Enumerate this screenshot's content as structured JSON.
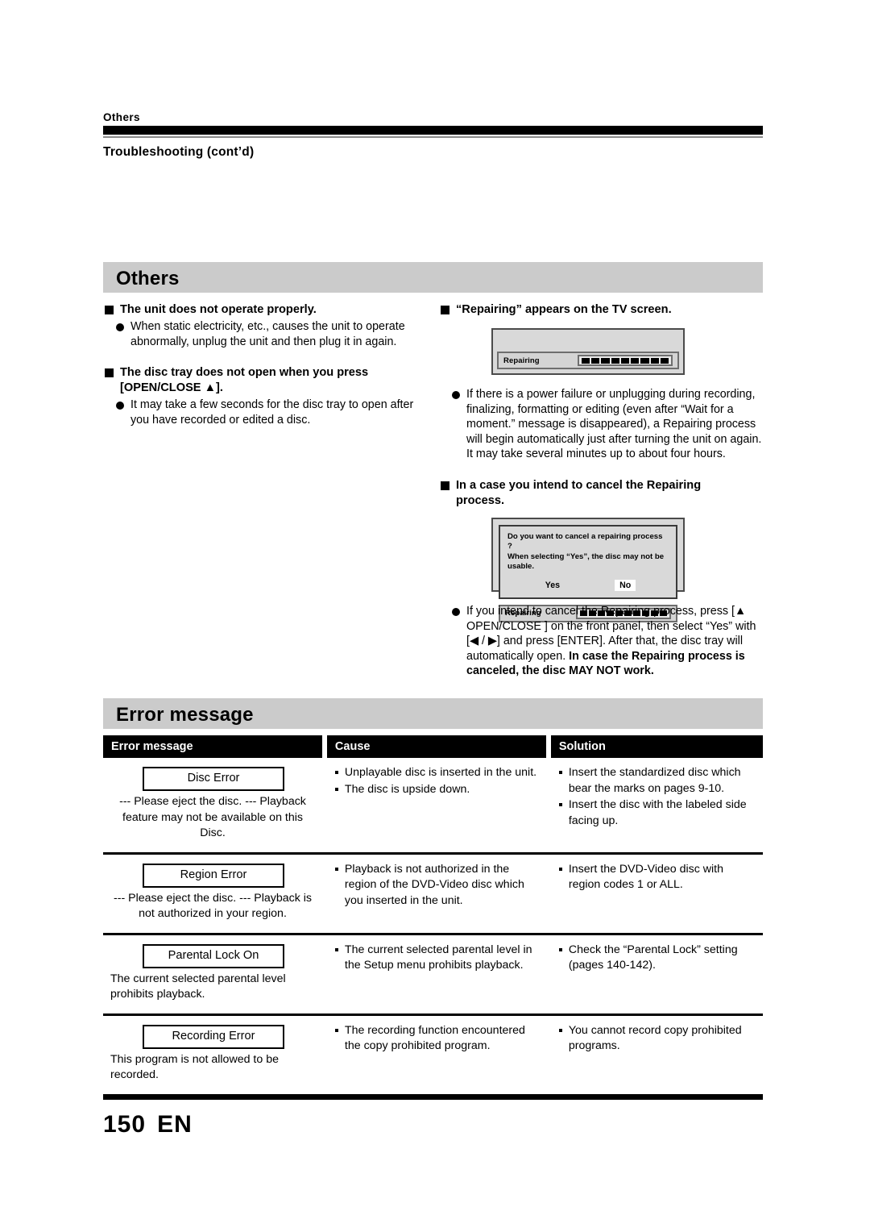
{
  "runhead": {
    "category": "Others",
    "title": "Troubleshooting (cont’d)"
  },
  "sections": {
    "others": "Others",
    "error_message": "Error message"
  },
  "left_column": {
    "q1_heading": "The unit does not operate properly.",
    "q1_bullet": "When static electricity, etc., causes the unit to operate abnormally, unplug the unit and then plug it in again.",
    "q2_heading_line1": "The disc tray does not open when you press",
    "q2_heading_line2": "[OPEN/CLOSE ▲].",
    "q2_bullet": "It may take a few seconds for the disc tray to open after you have recorded or edited a disc."
  },
  "right_column": {
    "q3_heading": "“Repairing” appears on the TV screen.",
    "screen1": {
      "progress_label": "Repairing",
      "segments": 9
    },
    "q3_bullet": "If there is a power failure or unplugging during recording, finalizing, formatting or editing (even after “Wait for a moment.” message is disappeared), a Repairing process will begin automatically just after turning the unit on again. It may take several minutes up to about four hours.",
    "q4_heading_line1": "In a case you intend to cancel the Repairing",
    "q4_heading_line2": "process.",
    "screen2": {
      "dialog_line1": "Do you want to cancel a repairing process ?",
      "dialog_line2": "When selecting “Yes”, the disc may not be",
      "dialog_line3": "usable.",
      "choice_yes": "Yes",
      "choice_no": "No",
      "selected_choice": "No",
      "progress_label": "Repairing",
      "segments": 10
    },
    "q4_bullet_normal": "If you intend to cancel the Repairing process, press [▲ OPEN/CLOSE ] on the front panel, then select “Yes” with [◀ / ▶] and press [ENTER]. After that, the disc tray will automatically open. ",
    "q4_bullet_bold": "In case the Repairing process is canceled, the disc MAY NOT work."
  },
  "error_table": {
    "headers": [
      "Error message",
      "Cause",
      "Solution"
    ],
    "rows": [
      {
        "message_box": "Disc Error",
        "message_sub": "--- Please eject the disc. --- Playback feature may not be available on this Disc.",
        "causes": [
          "Unplayable disc is inserted in the unit.",
          "The disc is upside down."
        ],
        "solutions": [
          "Insert the standardized disc which bear the marks on pages 9-10.",
          "Insert the disc with the labeled side facing up."
        ]
      },
      {
        "message_box": "Region Error",
        "message_sub": "--- Please eject the disc. --- Playback is not authorized in your region.",
        "causes": [
          "Playback is not authorized in the region of the DVD-Video disc which you inserted in the unit."
        ],
        "solutions": [
          "Insert the DVD-Video disc with region codes 1 or ALL."
        ]
      },
      {
        "message_box": "Parental Lock On",
        "message_sub": "The current selected parental level prohibits playback.",
        "causes": [
          "The current selected parental level in the Setup menu prohibits playback."
        ],
        "solutions": [
          "Check the “Parental Lock” setting (pages 140-142)."
        ]
      },
      {
        "message_box": "Recording Error",
        "message_sub": "This program is not allowed to be recorded.",
        "causes": [
          "The recording function encountered the copy prohibited program."
        ],
        "solutions": [
          "You cannot record copy prohibited programs."
        ]
      }
    ]
  },
  "footer": {
    "page_number": "150",
    "language_code": "EN"
  }
}
